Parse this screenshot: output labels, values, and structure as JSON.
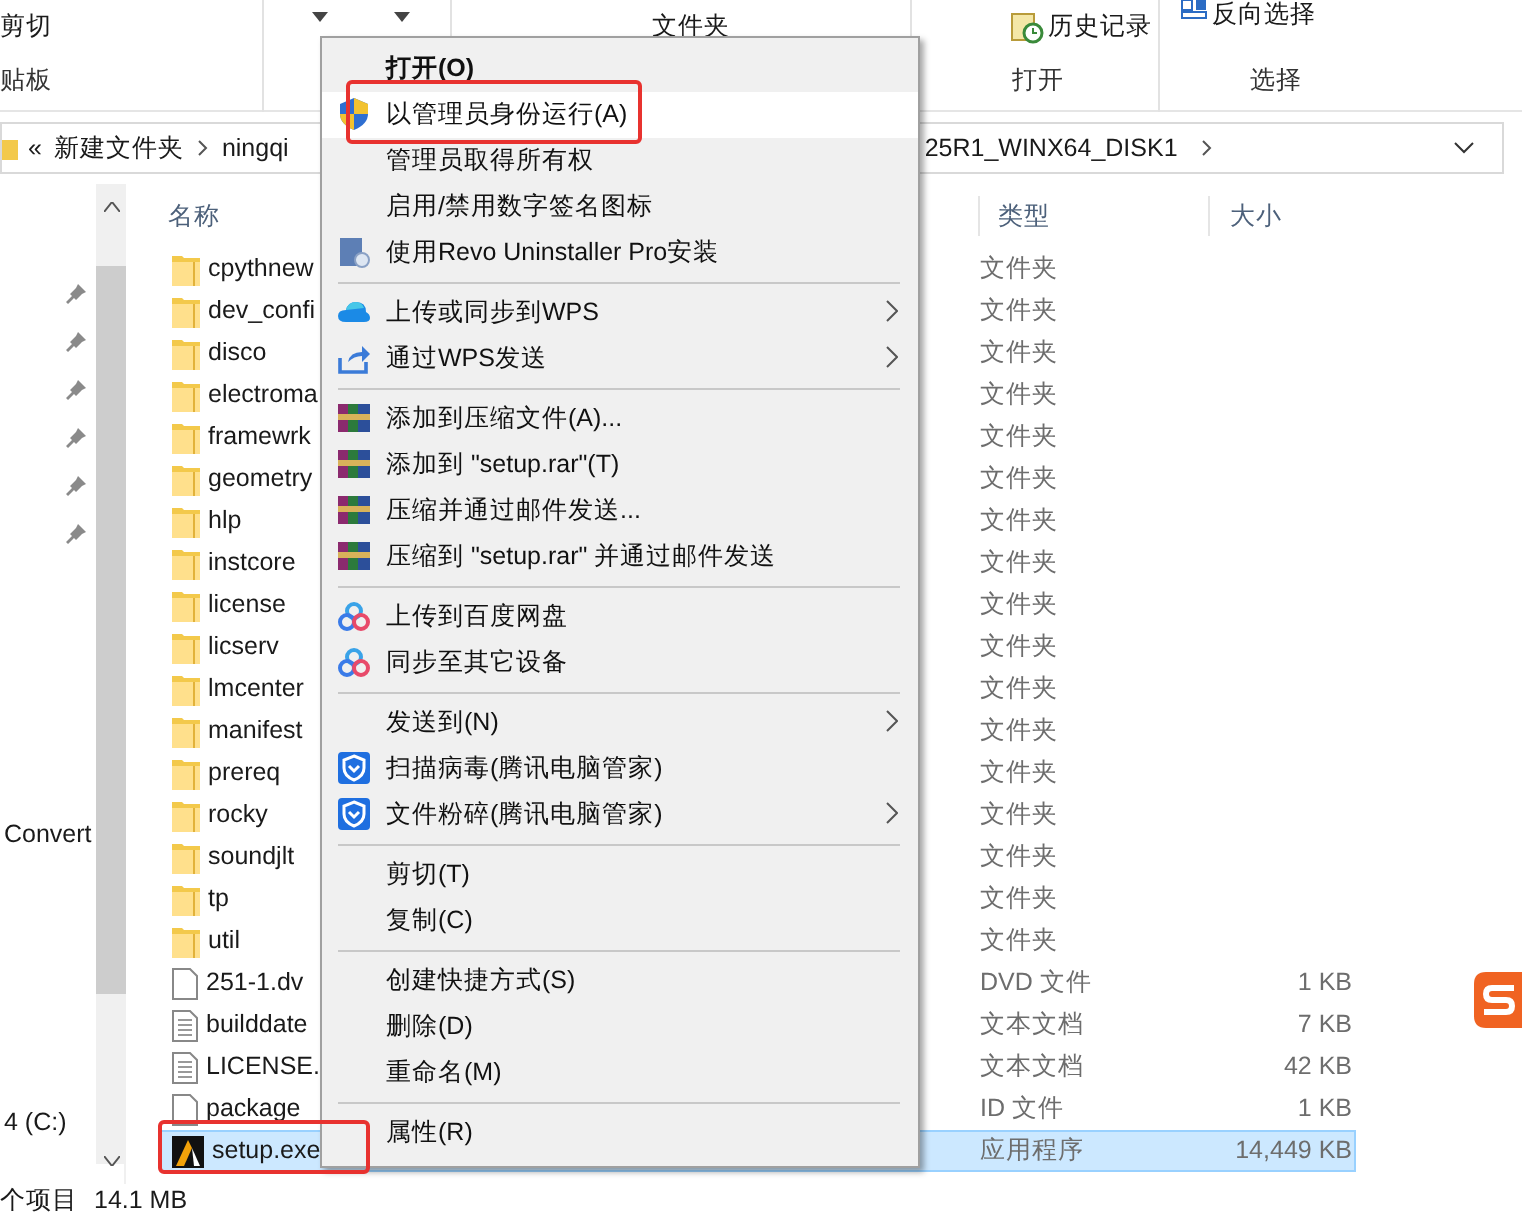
{
  "ribbon": {
    "cut": "剪切",
    "clipboard_group": "贴板",
    "new_folder": "文件夹",
    "history": "历史记录",
    "invert_selection": "反向选择",
    "open_group": "打开",
    "select_group": "选择"
  },
  "address_bar": {
    "overflow": "«",
    "crumbs": [
      "新建文件夹",
      "ningqi",
      "25R1_WINX64_DISK1"
    ]
  },
  "nav": {
    "items": [
      {
        "pinned": true
      },
      {
        "pinned": true
      },
      {
        "pinned": true
      },
      {
        "pinned": true
      },
      {
        "pinned": true
      },
      {
        "pinned": true
      },
      {
        "label": "Convert"
      },
      {
        "label": "4 (C:)"
      }
    ]
  },
  "columns": [
    "名称",
    "类型",
    "大小"
  ],
  "files": [
    {
      "name": "cpythnew",
      "kind": "folder",
      "type": "文件夹",
      "selected": false
    },
    {
      "name": "dev_confi",
      "kind": "folder",
      "type": "文件夹",
      "selected": false
    },
    {
      "name": "disco",
      "kind": "folder",
      "type": "文件夹",
      "selected": false
    },
    {
      "name": "electroma",
      "kind": "folder",
      "type": "文件夹",
      "selected": false
    },
    {
      "name": "framewrk",
      "kind": "folder",
      "type": "文件夹",
      "selected": false
    },
    {
      "name": "geometry",
      "kind": "folder",
      "type": "文件夹",
      "selected": false
    },
    {
      "name": "hlp",
      "kind": "folder",
      "type": "文件夹",
      "selected": false
    },
    {
      "name": "instcore",
      "kind": "folder",
      "type": "文件夹",
      "selected": false
    },
    {
      "name": "license",
      "kind": "folder",
      "type": "文件夹",
      "selected": false
    },
    {
      "name": "licserv",
      "kind": "folder",
      "type": "文件夹",
      "selected": false
    },
    {
      "name": "lmcenter",
      "kind": "folder",
      "type": "文件夹",
      "selected": false
    },
    {
      "name": "manifest",
      "kind": "folder",
      "type": "文件夹",
      "selected": false
    },
    {
      "name": "prereq",
      "kind": "folder",
      "type": "文件夹",
      "selected": false
    },
    {
      "name": "rocky",
      "kind": "folder",
      "type": "文件夹",
      "selected": false
    },
    {
      "name": "soundjlt",
      "kind": "folder",
      "type": "文件夹",
      "selected": false
    },
    {
      "name": "tp",
      "kind": "folder",
      "type": "文件夹",
      "selected": false
    },
    {
      "name": "util",
      "kind": "folder",
      "type": "文件夹",
      "selected": false
    },
    {
      "name": "251-1.dv",
      "kind": "file",
      "type": "DVD 文件",
      "size": "1 KB",
      "selected": false
    },
    {
      "name": "builddate",
      "kind": "text",
      "type": "文本文档",
      "size": "7 KB",
      "selected": false
    },
    {
      "name": "LICENSE.",
      "kind": "text",
      "type": "文本文档",
      "size": "42 KB",
      "selected": false
    },
    {
      "name": "package",
      "kind": "file",
      "type": "ID 文件",
      "size": "1 KB",
      "selected": false
    },
    {
      "name": "setup.exe",
      "kind": "app",
      "type": "应用程序",
      "size": "14,449 KB",
      "selected": true,
      "marked": true
    }
  ],
  "context_menu": {
    "items": [
      {
        "kind": "item",
        "label": "打开(O)",
        "default": true
      },
      {
        "kind": "shield",
        "label": "以管理员身份运行(A)",
        "highlighted": true,
        "marked": true
      },
      {
        "kind": "item",
        "label": "管理员取得所有权"
      },
      {
        "kind": "item",
        "label": "启用/禁用数字签名图标"
      },
      {
        "kind": "installer",
        "label": "使用Revo Uninstaller Pro安装"
      },
      {
        "kind": "separator"
      },
      {
        "kind": "cloud",
        "label": "上传或同步到WPS",
        "submenu": true
      },
      {
        "kind": "share",
        "label": "通过WPS发送",
        "submenu": true
      },
      {
        "kind": "separator"
      },
      {
        "kind": "archive",
        "label": "添加到压缩文件(A)..."
      },
      {
        "kind": "archive",
        "label": "添加到 \"setup.rar\"(T)"
      },
      {
        "kind": "archive",
        "label": "压缩并通过邮件发送..."
      },
      {
        "kind": "archive",
        "label": "压缩到 \"setup.rar\" 并通过邮件发送"
      },
      {
        "kind": "separator"
      },
      {
        "kind": "sync",
        "label": "上传到百度网盘"
      },
      {
        "kind": "sync",
        "label": "同步至其它设备"
      },
      {
        "kind": "separator"
      },
      {
        "kind": "item",
        "label": "发送到(N)",
        "submenu": true
      },
      {
        "kind": "antivirus",
        "label": "扫描病毒(腾讯电脑管家)"
      },
      {
        "kind": "antivirus",
        "label": "文件粉碎(腾讯电脑管家)",
        "submenu": true
      },
      {
        "kind": "separator"
      },
      {
        "kind": "item",
        "label": "剪切(T)"
      },
      {
        "kind": "item",
        "label": "复制(C)"
      },
      {
        "kind": "separator"
      },
      {
        "kind": "item",
        "label": "创建快捷方式(S)"
      },
      {
        "kind": "item",
        "label": "删除(D)"
      },
      {
        "kind": "item",
        "label": "重命名(M)"
      },
      {
        "kind": "separator"
      },
      {
        "kind": "item",
        "label": "属性(R)"
      }
    ]
  },
  "status_bar": {
    "count": "个项目",
    "size": "14.1 MB"
  }
}
